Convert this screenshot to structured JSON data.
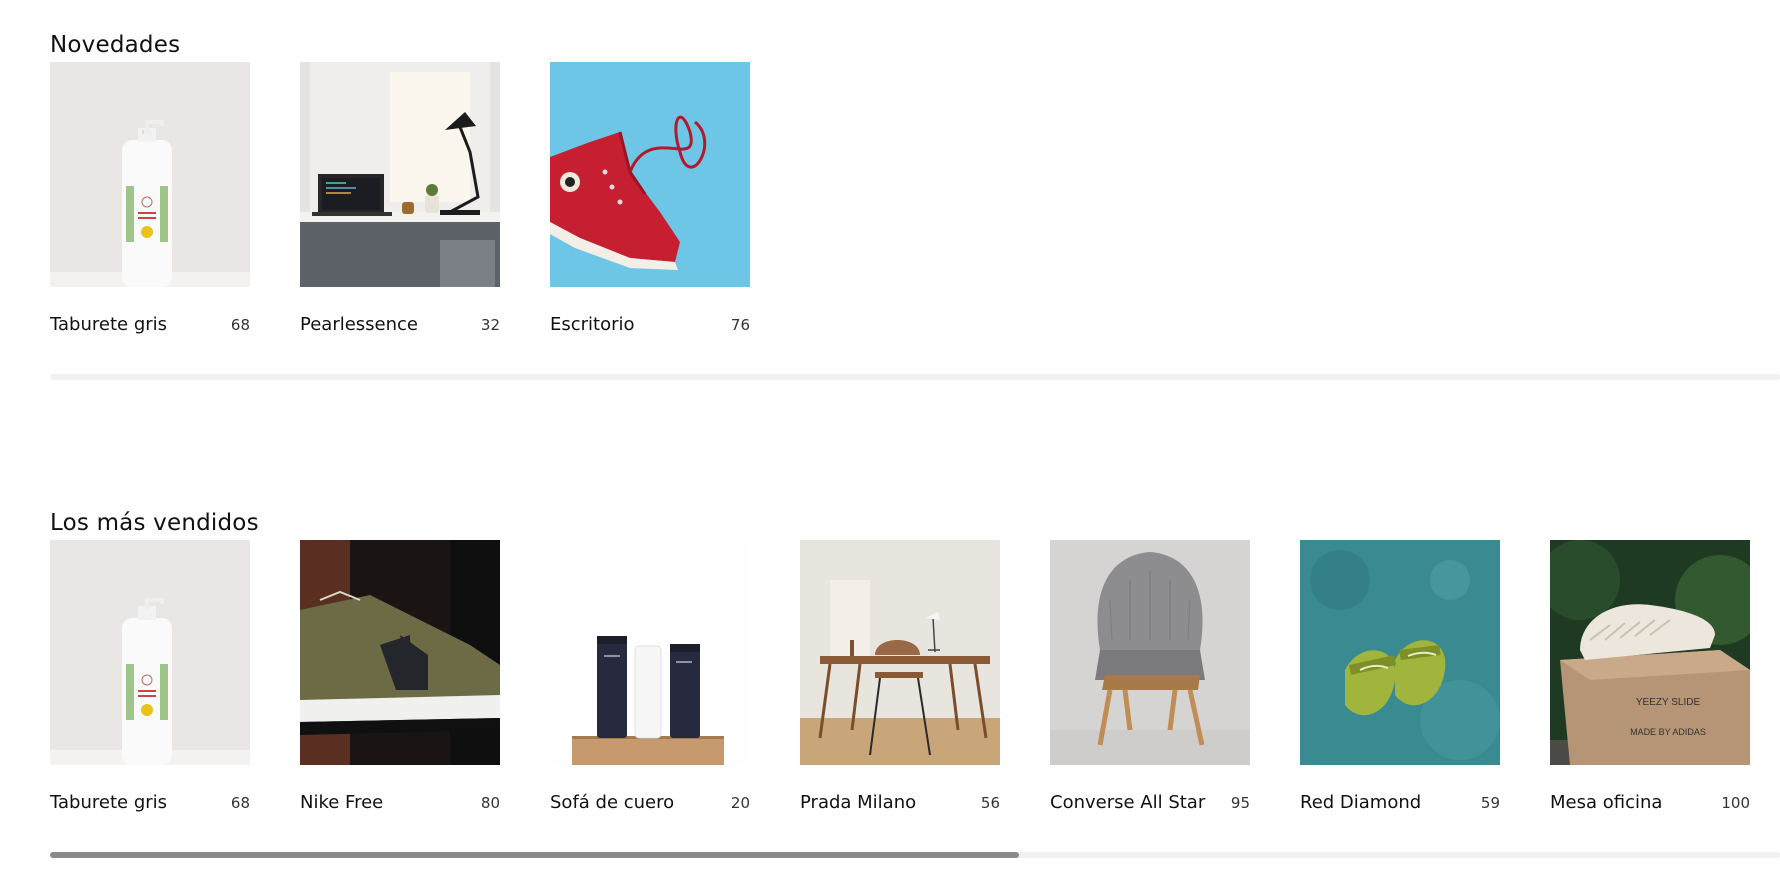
{
  "novedades": {
    "title": "Novedades",
    "scroll_thumb_fraction": 0,
    "products": [
      {
        "name": "Taburete gris",
        "count": "68",
        "image": "soap-bottle"
      },
      {
        "name": "Pearlessence",
        "count": "32",
        "image": "desk-laptop"
      },
      {
        "name": "Escritorio",
        "count": "76",
        "image": "red-sneaker"
      }
    ]
  },
  "mas_vendidos": {
    "title": "Los más vendidos",
    "scroll_thumb_fraction": 0.56,
    "products": [
      {
        "name": "Taburete gris",
        "count": "68",
        "image": "soap-bottle"
      },
      {
        "name": "Nike Free",
        "count": "80",
        "image": "green-sneaker"
      },
      {
        "name": "Sofá de cuero",
        "count": "20",
        "image": "cosmetic-tubes"
      },
      {
        "name": "Prada Milano",
        "count": "56",
        "image": "wood-desk"
      },
      {
        "name": "Converse All Star",
        "count": "95",
        "image": "armchair"
      },
      {
        "name": "Red Diamond",
        "count": "59",
        "image": "green-slides"
      },
      {
        "name": "Mesa oficina",
        "count": "100",
        "image": "yeezy-slides"
      }
    ]
  },
  "box_text": [
    "YEEZY SLIDE",
    "MADE BY ADIDAS"
  ]
}
